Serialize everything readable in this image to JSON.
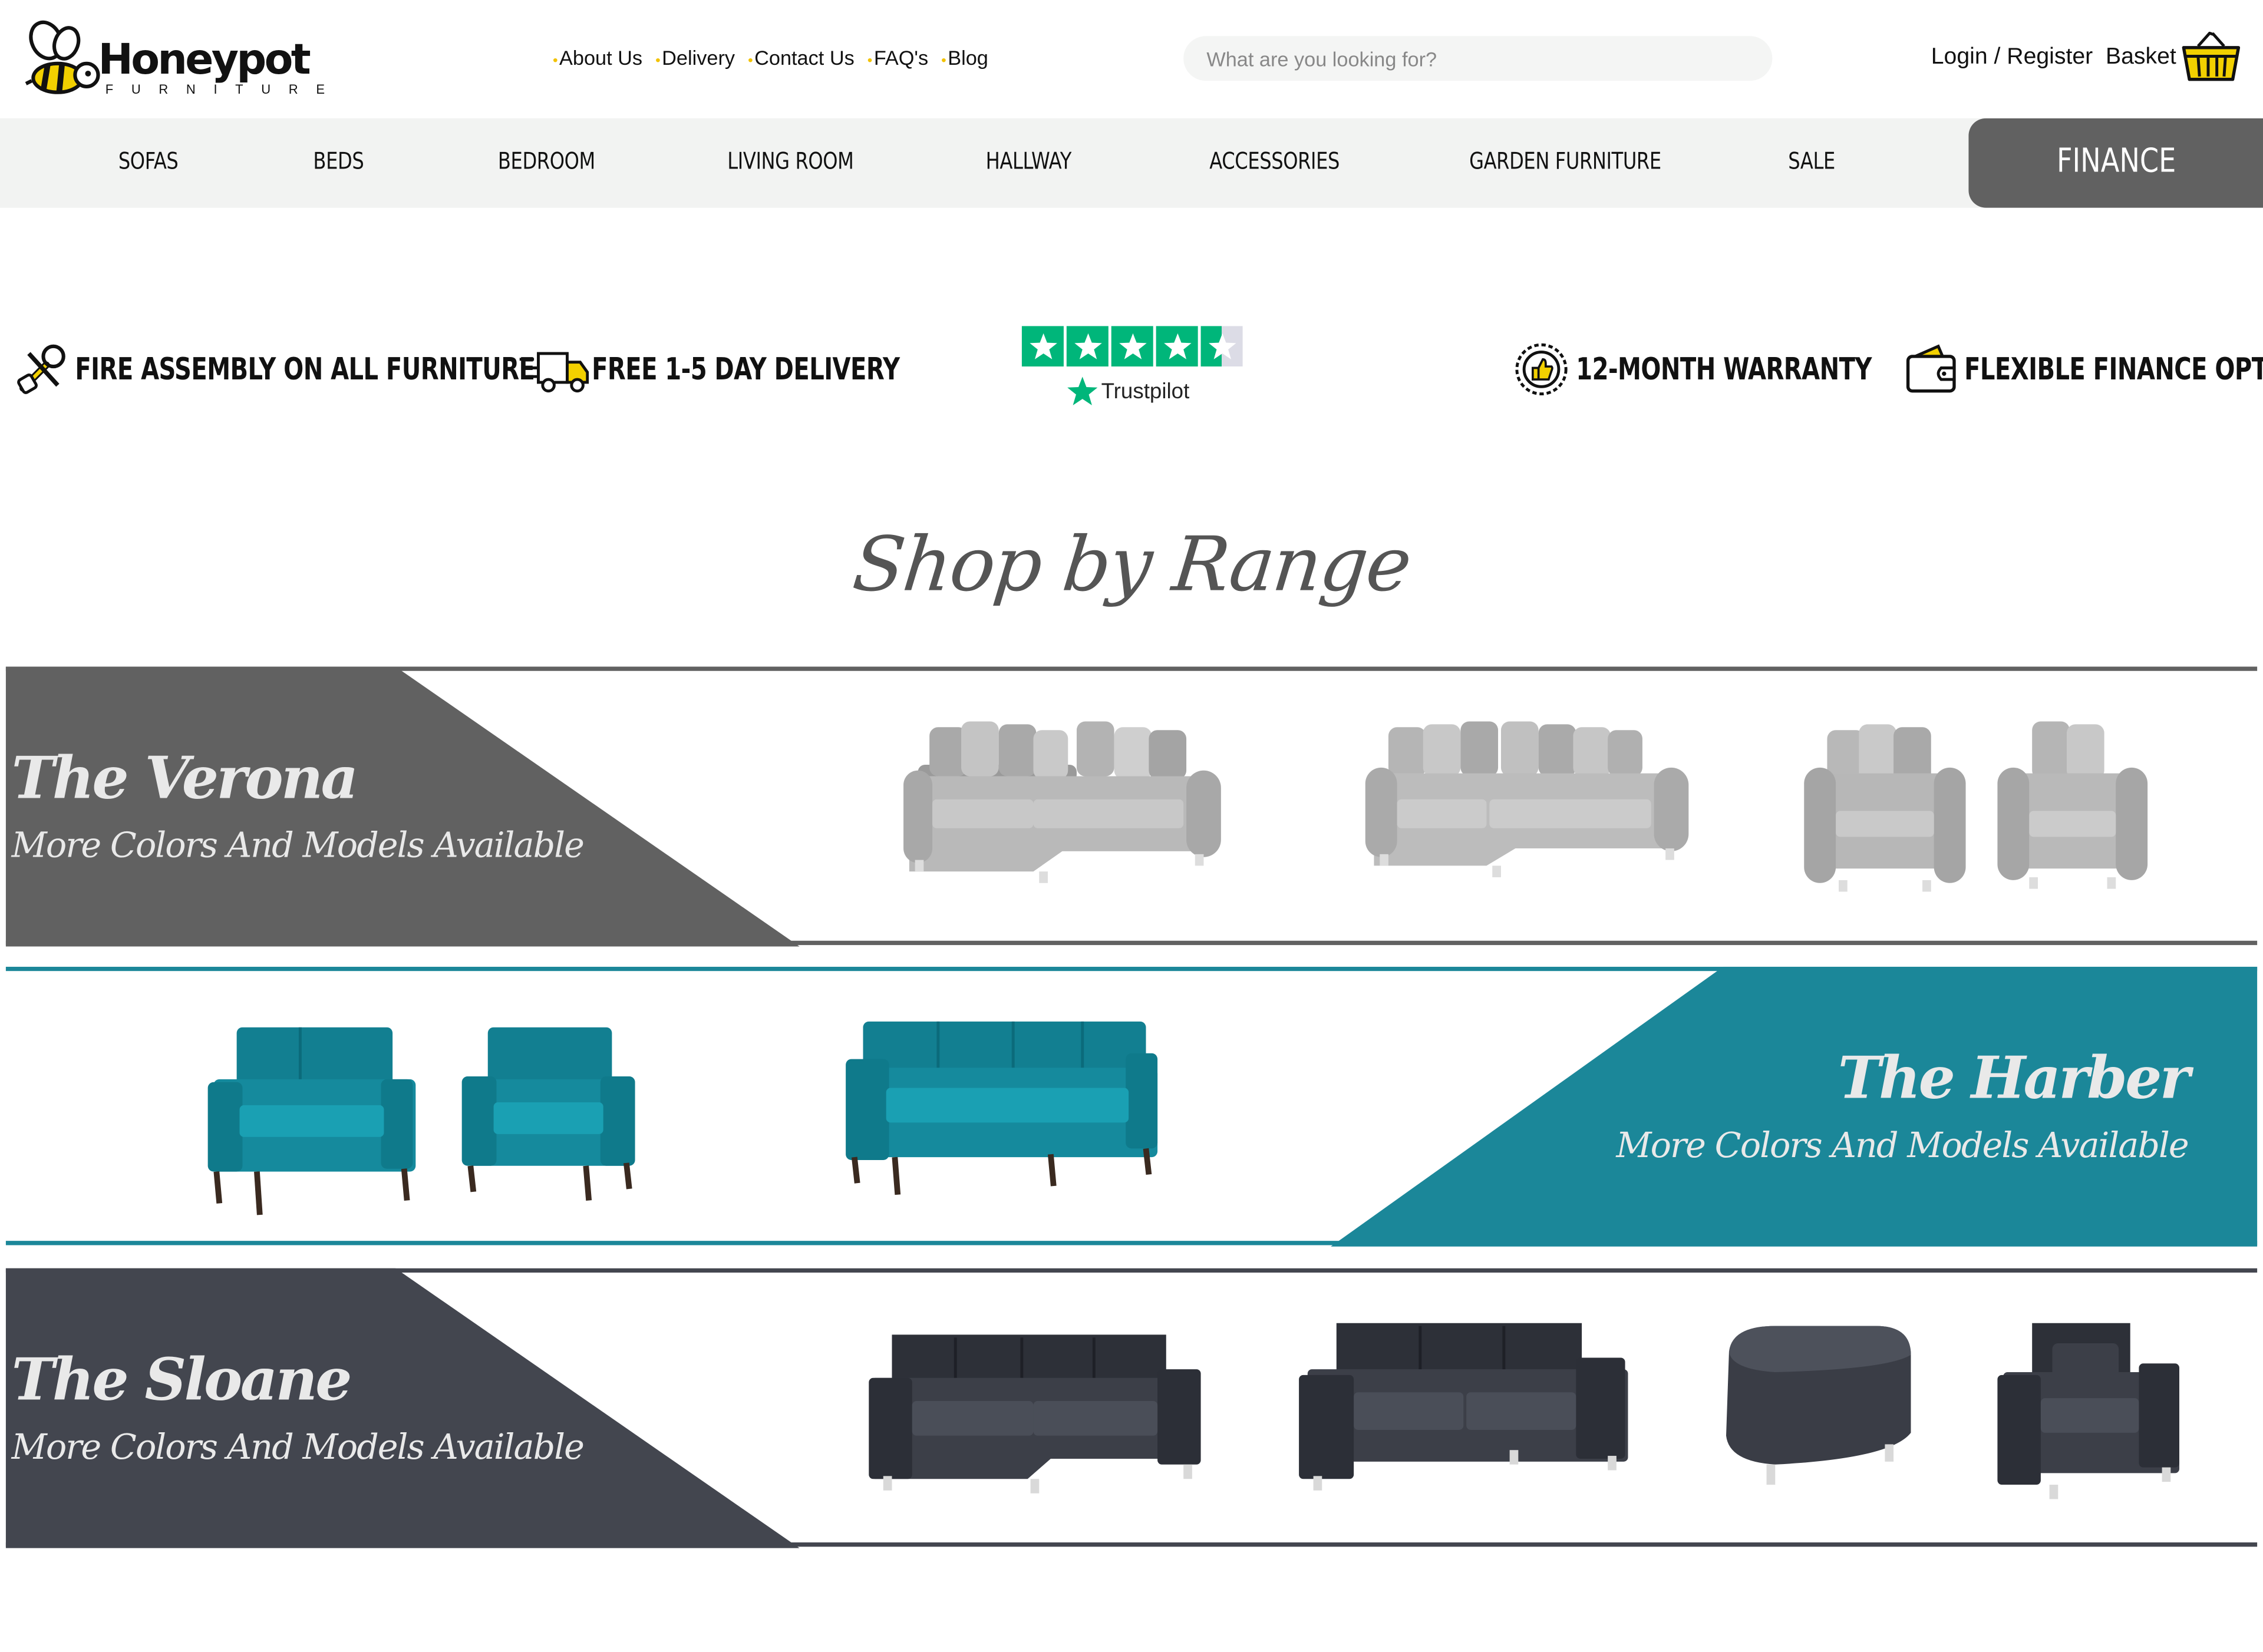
{
  "brand": {
    "name": "Honeypot",
    "subtitle": "FURNITURE"
  },
  "top_links": [
    "About Us",
    "Delivery",
    "Contact Us",
    "FAQ's",
    "Blog"
  ],
  "search": {
    "placeholder": "What are you looking for?",
    "value": ""
  },
  "account": {
    "login": "Login / Register",
    "basket": "Basket"
  },
  "nav": {
    "items": [
      "SOFAS",
      "BEDS",
      "BEDROOM",
      "LIVING ROOM",
      "HALLWAY",
      "ACCESSORIES",
      "GARDEN FURNITURE",
      "SALE"
    ],
    "finance": "FINANCE"
  },
  "usps": [
    {
      "icon": "tools-icon",
      "label": "FIRE ASSEMBLY ON ALL FURNITURE"
    },
    {
      "icon": "delivery-truck-icon",
      "label": "FREE 1-5 DAY DELIVERY"
    },
    {
      "icon": "warranty-badge-icon",
      "label": "12-MONTH WARRANTY"
    },
    {
      "icon": "wallet-icon",
      "label": "FLEXIBLE FINANCE OPTIONS"
    }
  ],
  "trustpilot": {
    "label": "Trustpilot",
    "stars": 4.5
  },
  "section_heading": "Shop by Range",
  "ranges": [
    {
      "title": "The Verona",
      "subtitle": "More Colors And Models Available",
      "color": "#616161"
    },
    {
      "title": "The Harber",
      "subtitle": "More Colors And Models Available",
      "color": "#1b8799"
    },
    {
      "title": "The Sloane",
      "subtitle": "More Colors And Models Available",
      "color": "#43464f"
    }
  ],
  "colors": {
    "accent": "#f2c200",
    "nav_bg": "#f2f3f2",
    "finance_bg": "#616161",
    "trustpilot_green": "#00b67a"
  }
}
